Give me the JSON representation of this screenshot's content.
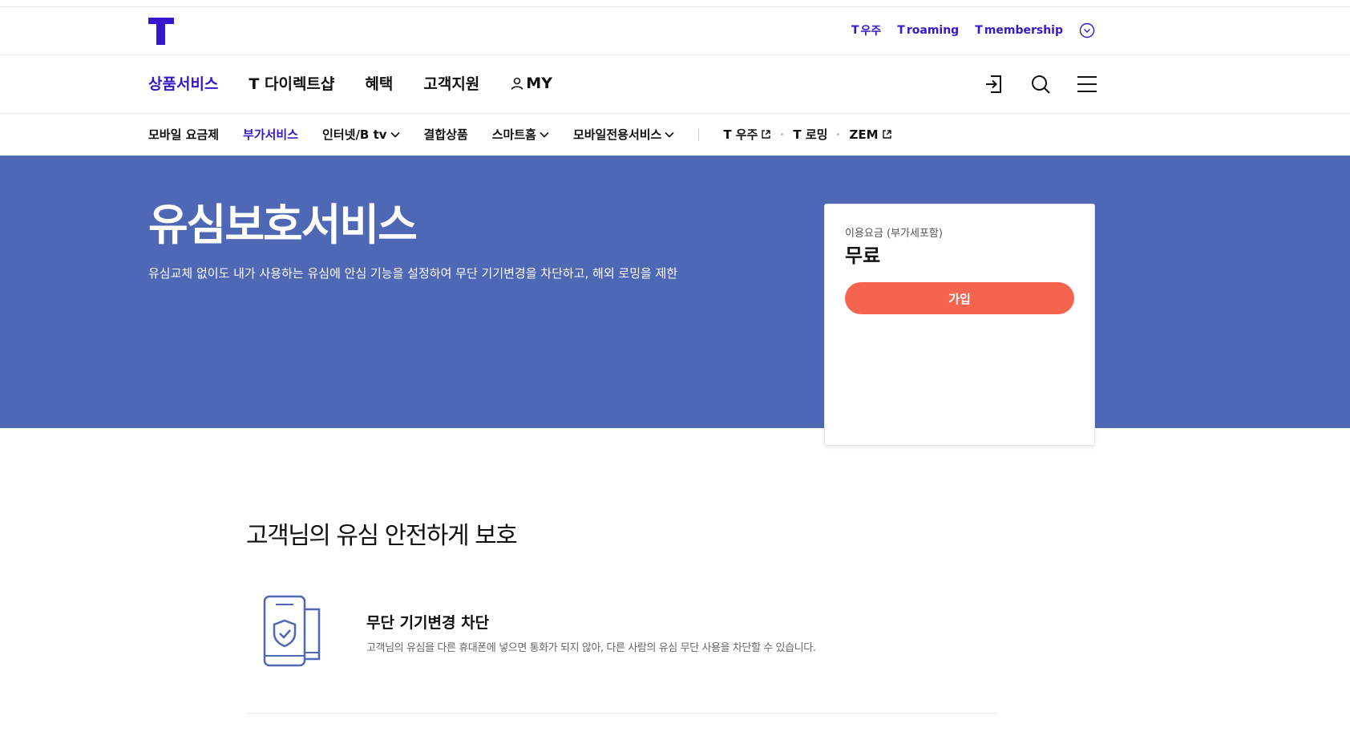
{
  "util_links": [
    {
      "label": "우주"
    },
    {
      "label": "roaming"
    },
    {
      "label": "membership"
    }
  ],
  "gnb": {
    "items": [
      {
        "label": "상품서비스",
        "active": true
      },
      {
        "label": "T 다이렉트샵"
      },
      {
        "label": "혜택"
      },
      {
        "label": "고객지원"
      },
      {
        "label": "MY"
      }
    ]
  },
  "lnb": {
    "items": [
      {
        "label": "모바일 요금제"
      },
      {
        "label": "부가서비스",
        "active": true
      },
      {
        "label": "인터넷/B tv"
      },
      {
        "label": "결합상품"
      },
      {
        "label": "스마트홈"
      },
      {
        "label": "모바일전용서비스"
      }
    ],
    "external": [
      {
        "label": "T 우주"
      },
      {
        "label": "T 로밍"
      },
      {
        "label": "ZEM"
      }
    ]
  },
  "hero": {
    "title": "유심보호서비스",
    "description": "유심교체 없이도 내가 사용하는 유심에 안심 기능을 설정하여 무단 기기변경을 차단하고, 해외 로밍을 제한"
  },
  "price_card": {
    "label": "이용요금 (부가세포함)",
    "value": "무료",
    "join_label": "가입"
  },
  "section": {
    "title": "고객님의 유심 안전하게 보호",
    "feature": {
      "title": "무단 기기변경 차단",
      "description": "고객님의 유심을 다른 휴대폰에 넣으면 통화가 되지 않아, 다른 사람의 유심 무단 사용을 차단할 수 있습니다."
    }
  },
  "colors": {
    "brand": "#3617ce",
    "hero_bg": "#4f68b6",
    "join_button": "#f5644f"
  },
  "icons": [
    "t-logo",
    "chevron-circle-icon",
    "user-icon",
    "login-icon",
    "search-icon",
    "menu-icon",
    "chevron-down-icon",
    "external-link-icon",
    "phone-shield-icon"
  ]
}
